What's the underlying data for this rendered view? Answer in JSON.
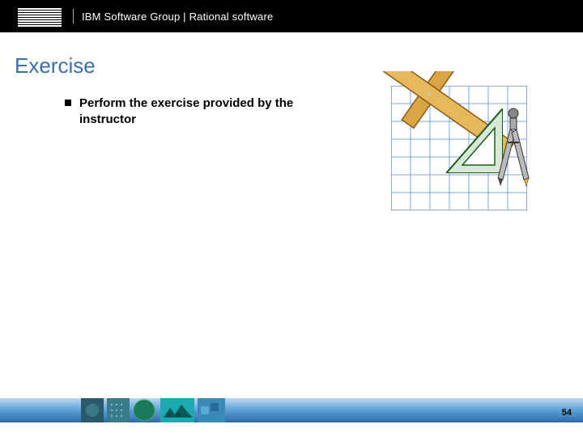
{
  "header": {
    "group_text": "IBM Software Group | Rational software",
    "logo_label": "IBM"
  },
  "title": "Exercise",
  "bullets": [
    "Perform the exercise provided by the instructor"
  ],
  "illustration_alt": "Drafting tools: graph paper, T-square, triangle, compass",
  "page_number": "54"
}
